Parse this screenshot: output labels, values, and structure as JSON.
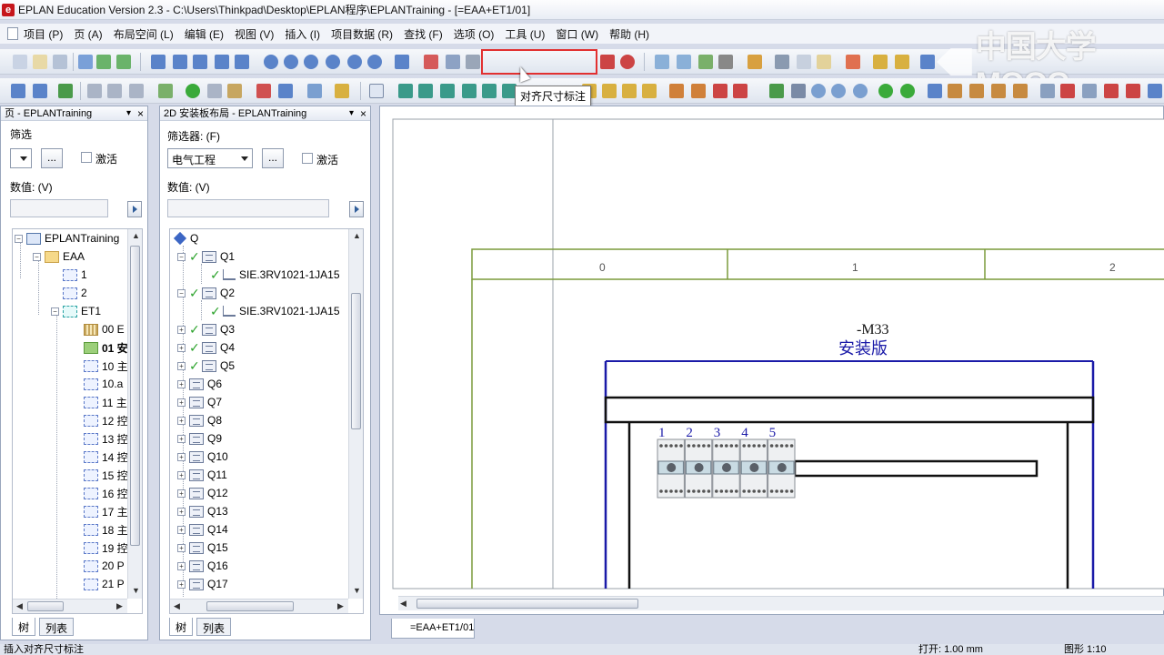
{
  "window": {
    "title": "EPLAN Education Version 2.3 - C:\\Users\\Thinkpad\\Desktop\\EPLAN程序\\EPLANTraining - [=EAA+ET1/01]"
  },
  "menu": [
    "项目 (P)",
    "页 (A)",
    "布局空间 (L)",
    "编辑 (E)",
    "视图 (V)",
    "插入 (I)",
    "项目数据 (R)",
    "查找 (F)",
    "选项 (O)",
    "工具 (U)",
    "窗口 (W)",
    "帮助 (H)"
  ],
  "toolbar": {
    "tooltip": "对齐尺寸标注",
    "watermark": "中国大学MOOC"
  },
  "left_panel": {
    "title": "页 - EPLANTraining",
    "filter_label": "筛选",
    "filter_value": "",
    "ellipsis": "...",
    "activate_label": "激活",
    "value_label": "数值: (V)",
    "tree": [
      {
        "label": "EPLANTraining",
        "icon": "project-icon"
      },
      {
        "label": "EAA",
        "icon": "folder-icon"
      },
      {
        "label": "1",
        "icon": "page-icon"
      },
      {
        "label": "2",
        "icon": "page-icon"
      },
      {
        "label": "ET1",
        "icon": "location-icon"
      },
      {
        "label": "00 E",
        "icon": "grid-page-icon"
      },
      {
        "label": "01 安",
        "icon": "layout-page-icon"
      },
      {
        "label": "10 主",
        "icon": "page-icon"
      },
      {
        "label": "10.a",
        "icon": "page-icon"
      },
      {
        "label": "11 主",
        "icon": "page-icon"
      },
      {
        "label": "12 控",
        "icon": "page-icon"
      },
      {
        "label": "13 控",
        "icon": "page-icon"
      },
      {
        "label": "14 控",
        "icon": "page-icon"
      },
      {
        "label": "15 控",
        "icon": "page-icon"
      },
      {
        "label": "16 控",
        "icon": "page-icon"
      },
      {
        "label": "17 主",
        "icon": "page-icon"
      },
      {
        "label": "18 主",
        "icon": "page-icon"
      },
      {
        "label": "19 控",
        "icon": "page-icon"
      },
      {
        "label": "20 P",
        "icon": "page-icon"
      },
      {
        "label": "21 P",
        "icon": "page-icon"
      }
    ],
    "tabs": [
      "树",
      "列表"
    ]
  },
  "mid_panel": {
    "title": "2D 安装板布局 - EPLANTraining",
    "filter_label": "筛选器: (F)",
    "filter_value": "电气工程",
    "ellipsis": "...",
    "activate_label": "激活",
    "value_label": "数值: (V)",
    "tree_root": "Q",
    "tree": [
      {
        "label": "Q1",
        "expanded": true
      },
      {
        "label": "SIE.3RV1021-1JA15",
        "child": true
      },
      {
        "label": "Q2",
        "expanded": true
      },
      {
        "label": "SIE.3RV1021-1JA15",
        "child": true
      },
      {
        "label": "Q3"
      },
      {
        "label": "Q4"
      },
      {
        "label": "Q5"
      },
      {
        "label": "Q6"
      },
      {
        "label": "Q7"
      },
      {
        "label": "Q8"
      },
      {
        "label": "Q9"
      },
      {
        "label": "Q10"
      },
      {
        "label": "Q11"
      },
      {
        "label": "Q12"
      },
      {
        "label": "Q13"
      },
      {
        "label": "Q14"
      },
      {
        "label": "Q15"
      },
      {
        "label": "Q16"
      },
      {
        "label": "Q17"
      }
    ],
    "tabs": [
      "树",
      "列表"
    ]
  },
  "drawing": {
    "columns": [
      "0",
      "1",
      "2"
    ],
    "device_tag": "-M33",
    "plate_label": "安装版",
    "slot_numbers": [
      "1",
      "2",
      "3",
      "4",
      "5"
    ],
    "doc_tab": "=EAA+ET1/01"
  },
  "status": {
    "left": "插入对齐尺寸标注",
    "mid": "打开: 1.00 mm",
    "right": "图形 1:10"
  },
  "colors": {
    "highlight": "#e23030",
    "frame_green": "#7a9a3a",
    "plate_blue": "#1a1aa8"
  }
}
